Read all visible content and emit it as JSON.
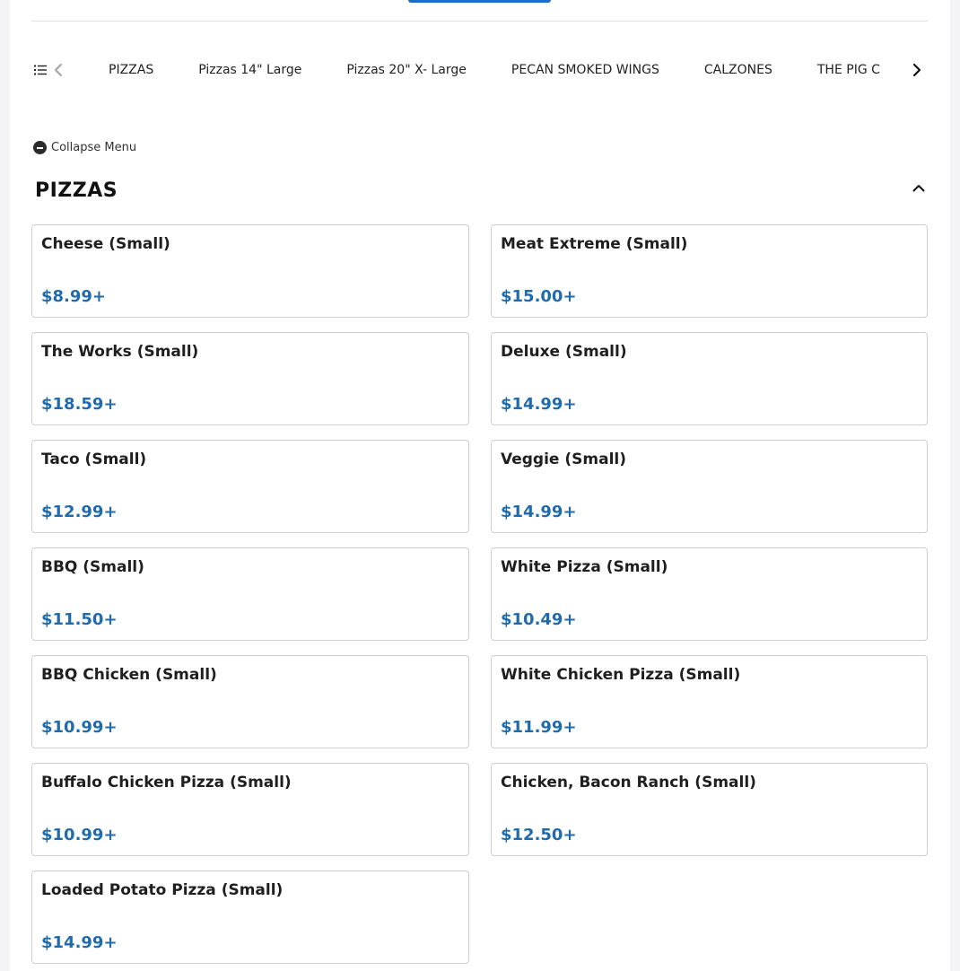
{
  "header": {
    "action_button_label": ""
  },
  "category_nav": {
    "list_icon": "list-icon",
    "prev_icon": "chevron-left-icon",
    "next_icon": "chevron-right-icon",
    "items": [
      {
        "label": "PIZZAS"
      },
      {
        "label": "Pizzas 14\" Large"
      },
      {
        "label": "Pizzas 20\" X- Large"
      },
      {
        "label": "PECAN SMOKED WINGS"
      },
      {
        "label": "CALZONES"
      },
      {
        "label": "THE PIG C"
      }
    ]
  },
  "collapse": {
    "label": "Collapse Menu",
    "icon": "minus-circle-icon"
  },
  "section": {
    "title": "PIZZAS",
    "toggle_icon": "chevron-up-icon",
    "items": [
      {
        "name": "Cheese (Small)",
        "price": "$8.99+"
      },
      {
        "name": "Meat Extreme (Small)",
        "price": "$15.00+"
      },
      {
        "name": "The Works (Small)",
        "price": "$18.59+"
      },
      {
        "name": "Deluxe (Small)",
        "price": "$14.99+"
      },
      {
        "name": "Taco (Small)",
        "price": "$12.99+"
      },
      {
        "name": "Veggie (Small)",
        "price": "$14.99+"
      },
      {
        "name": "BBQ (Small)",
        "price": "$11.50+"
      },
      {
        "name": "White Pizza (Small)",
        "price": "$10.49+"
      },
      {
        "name": "BBQ Chicken (Small)",
        "price": "$10.99+"
      },
      {
        "name": "White Chicken Pizza (Small)",
        "price": "$11.99+"
      },
      {
        "name": "Buffalo Chicken Pizza (Small)",
        "price": "$10.99+"
      },
      {
        "name": "Chicken, Bacon Ranch (Small)",
        "price": "$12.50+"
      },
      {
        "name": "Loaded Potato Pizza (Small)",
        "price": "$14.99+"
      }
    ]
  },
  "colors": {
    "accent": "#1f6bc9",
    "price": "#1f6bae",
    "card_border": "#cfcfcf"
  }
}
